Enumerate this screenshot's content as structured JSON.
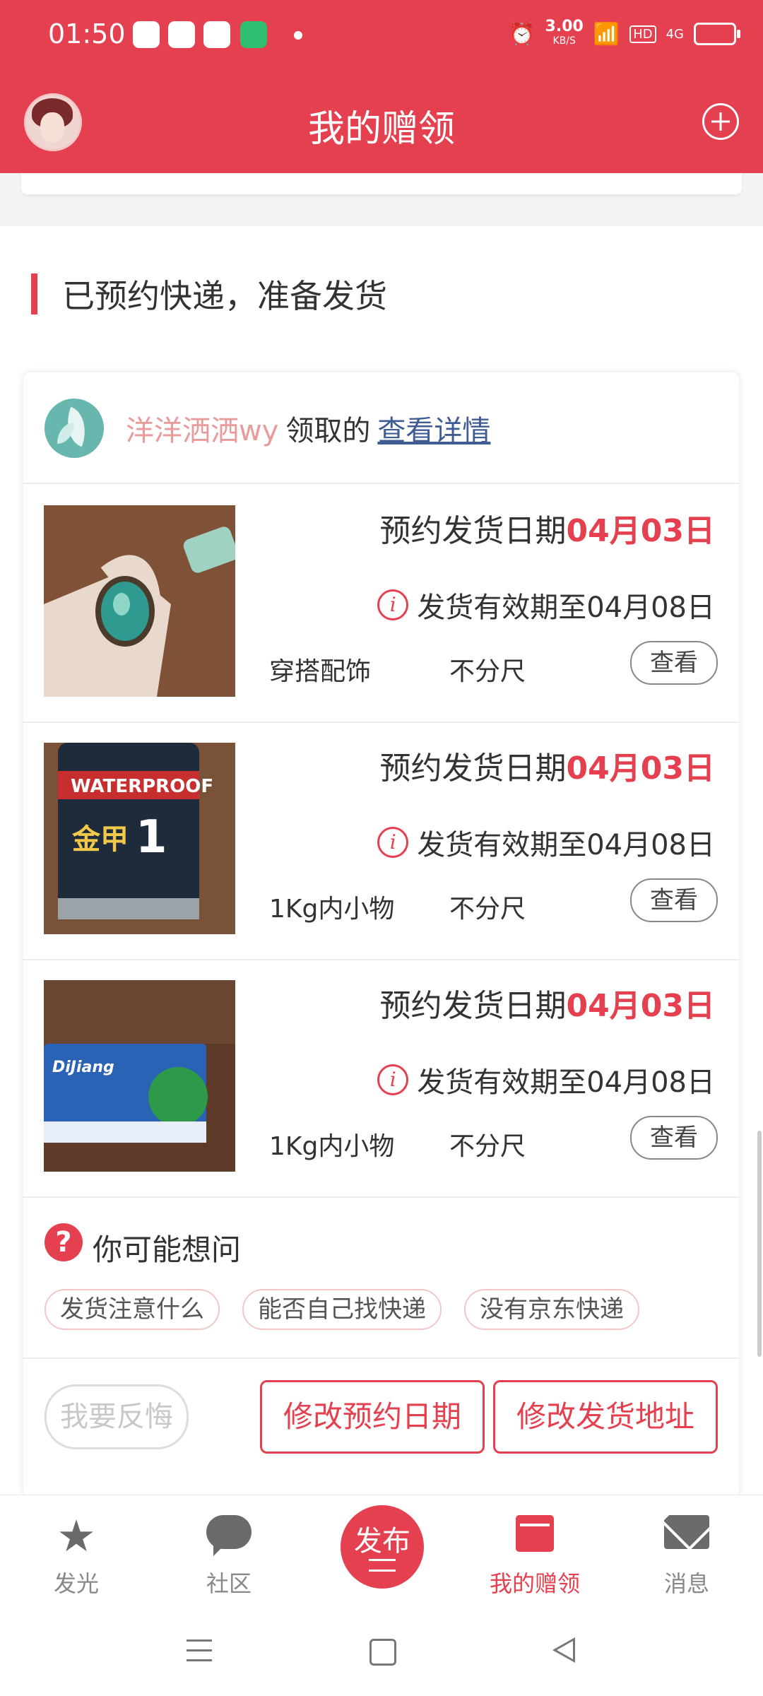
{
  "status_bar": {
    "time": "01:50",
    "speed_top": "3.00",
    "speed_bottom": "KB/S",
    "hd": "HD",
    "net": "4G"
  },
  "header": {
    "title": "我的赠领"
  },
  "section": {
    "title": "已预约快递，准备发货"
  },
  "giver": {
    "name": "洋洋洒洒wy",
    "received_text": "领取的",
    "detail_link": "查看详情"
  },
  "items": [
    {
      "date_prefix": "预约发货日期",
      "date": "04月03日",
      "valid_text": "发货有效期至04月08日",
      "category": "穿搭配饰",
      "size": "不分尺",
      "view_label": "查看"
    },
    {
      "date_prefix": "预约发货日期",
      "date": "04月03日",
      "valid_text": "发货有效期至04月08日",
      "category": "1Kg内小物",
      "size": "不分尺",
      "view_label": "查看"
    },
    {
      "date_prefix": "预约发货日期",
      "date": "04月03日",
      "valid_text": "发货有效期至04月08日",
      "category": "1Kg内小物",
      "size": "不分尺",
      "view_label": "查看"
    }
  ],
  "faq": {
    "title": "你可能想问",
    "chips": [
      "发货注意什么",
      "能否自己找快递",
      "没有京东快递"
    ]
  },
  "actions": {
    "regret": "我要反悔",
    "modify_date": "修改预约日期",
    "modify_address": "修改发货地址"
  },
  "bottom_nav": [
    {
      "label": "发光",
      "icon": "star-icon"
    },
    {
      "label": "社区",
      "icon": "chat-bubble-icon"
    },
    {
      "label": "发布",
      "icon": "publish-icon"
    },
    {
      "label": "我的赠领",
      "icon": "gift-box-icon"
    },
    {
      "label": "消息",
      "icon": "envelope-icon"
    }
  ],
  "colors": {
    "accent": "#e5404f",
    "link": "#3f5d92",
    "giver_name": "#e99a9a"
  }
}
